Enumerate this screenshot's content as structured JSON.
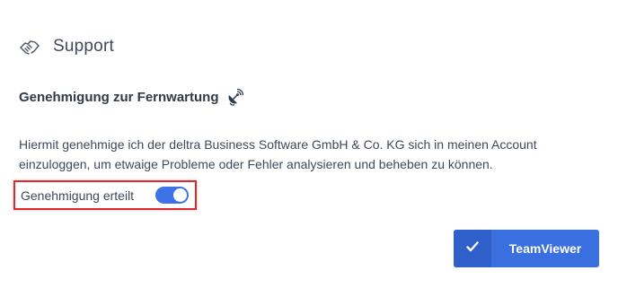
{
  "header": {
    "title": "Support",
    "icon": "handshake-icon"
  },
  "section": {
    "title": "Genehmigung zur Fernwartung",
    "icon": "satellite-dish-icon"
  },
  "description": {
    "line1": "Hiermit genehmige ich der deltra Business Software GmbH & Co. KG sich in meinen Account",
    "line2": "einzuloggen, um etwaige Probleme oder Fehler analysieren und beheben zu können."
  },
  "toggle": {
    "label": "Genehmigung erteilt",
    "state": true
  },
  "button": {
    "label": "TeamViewer",
    "icon": "check-icon"
  },
  "colors": {
    "accent": "#3a6fe0",
    "accent_dark": "#2f5fcb",
    "highlight_border": "#e0262b",
    "text": "#3d4a5c"
  }
}
